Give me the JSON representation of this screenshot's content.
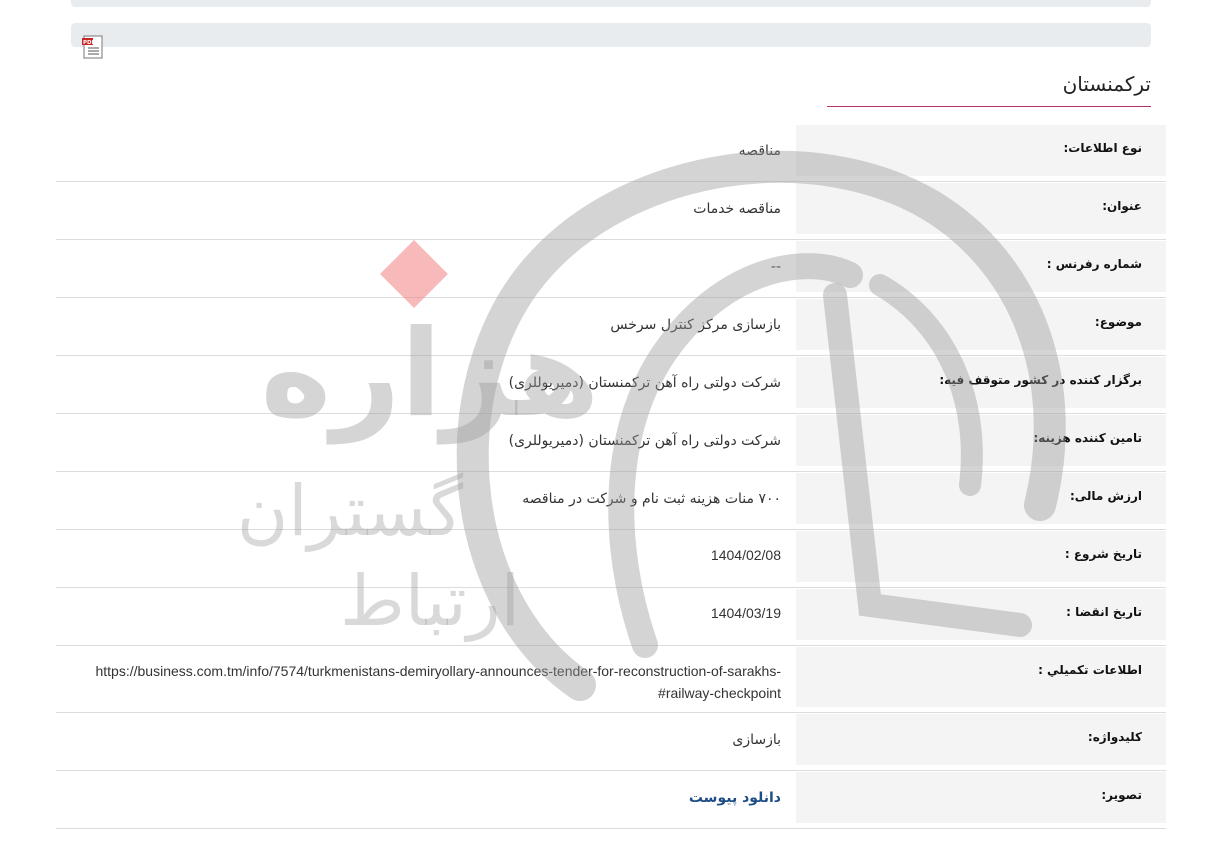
{
  "header": {
    "pdf_icon": "pdf-document-icon",
    "country_title": "ترکمنستان"
  },
  "rows": [
    {
      "label": "نوع اطلاعات:",
      "value": "مناقصه"
    },
    {
      "label": "عنوان:",
      "value": "مناقصه خدمات"
    },
    {
      "label": "شماره رفرنس :",
      "value": "--"
    },
    {
      "label": "موضوع:",
      "value": "بازسازی مرکز کنترل سرخس"
    },
    {
      "label": "برگزار کننده در کشور متوقف فیه:",
      "value": "شرکت دولتی راه آهن ترکمنستان (دمیریوللری)"
    },
    {
      "label": "تامین کننده هزینه:",
      "value": "شرکت دولتی راه آهن ترکمنستان (دمیریوللری)"
    },
    {
      "label": "ارزش مالی:",
      "value": "۷۰۰ منات هزینه ثبت نام و شرکت در مناقصه"
    },
    {
      "label": "تاریخ شروع :",
      "value": "1404/02/08"
    },
    {
      "label": "تاریخ انقضا :",
      "value": "1404/03/19"
    },
    {
      "label": "اطلاعات تکمیلي :",
      "value": "https://business.com.tm/info/7574/turkmenistans-demiryollary-announces-tender-for-reconstruction-of-sarakhs-railway-checkpoint#"
    },
    {
      "label": "کلیدواژه:",
      "value": "بازسازی"
    },
    {
      "label": "تصویر:",
      "value": "دانلود پیوست"
    }
  ],
  "watermark": {
    "text_main": "هزاره",
    "text_sub1": "گستران",
    "text_sub2": "ارتباط"
  },
  "colors": {
    "accent_line": "#b0306a",
    "link": "#1f4e86",
    "label_bg": "#f4f4f4"
  }
}
